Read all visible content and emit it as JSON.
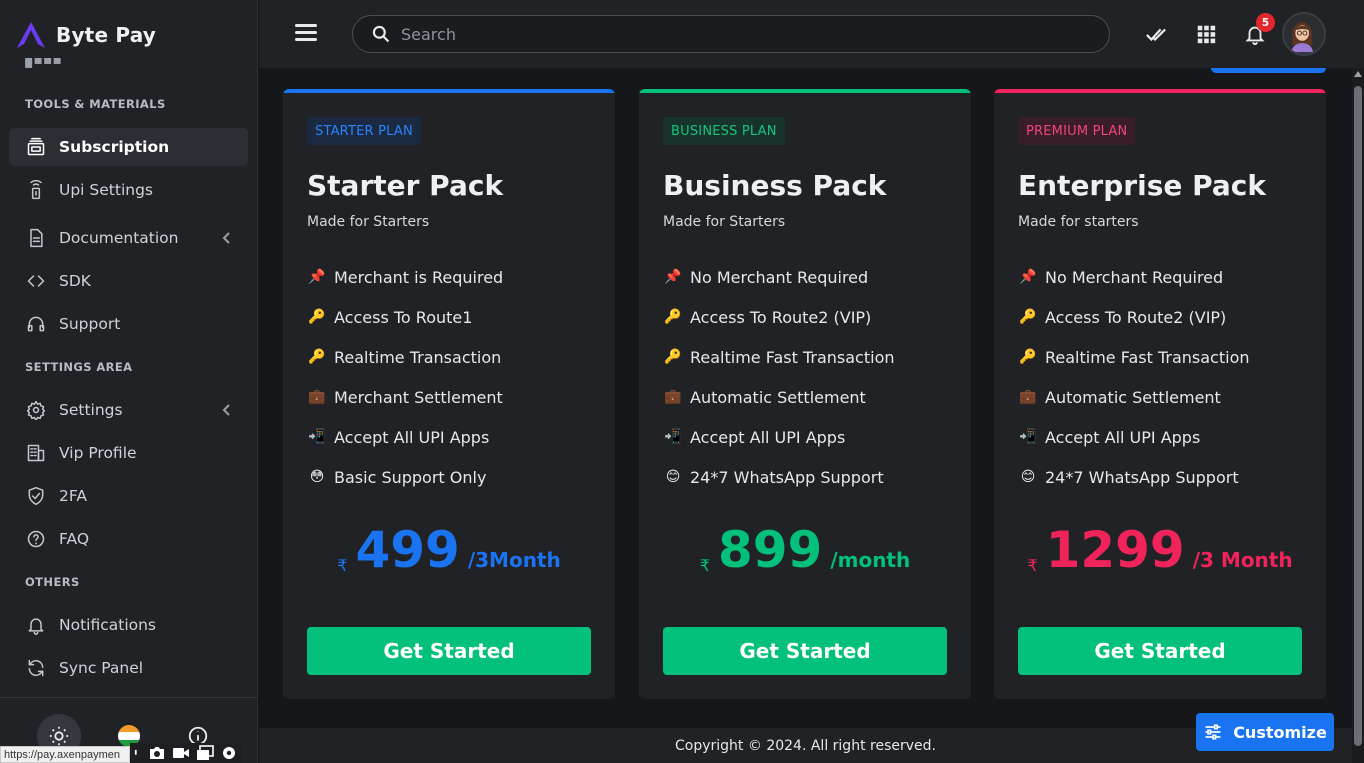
{
  "brand": {
    "name": "Byte Pay"
  },
  "sidebar": {
    "sections": [
      {
        "title": "TOOLS & MATERIALS"
      },
      {
        "title": "SETTINGS AREA"
      },
      {
        "title": "OTHERS"
      }
    ],
    "items": [
      {
        "label": "Subscription",
        "icon": "subscription-icon",
        "active": true
      },
      {
        "label": "Upi Settings",
        "icon": "upi-icon"
      },
      {
        "label": "Documentation",
        "icon": "document-icon",
        "chevron": true
      },
      {
        "label": "SDK",
        "icon": "code-icon"
      },
      {
        "label": "Support",
        "icon": "headset-icon"
      },
      {
        "label": "Settings",
        "icon": "gear-icon",
        "chevron": true
      },
      {
        "label": "Vip Profile",
        "icon": "building-icon"
      },
      {
        "label": "2FA",
        "icon": "shield-check-icon"
      },
      {
        "label": "FAQ",
        "icon": "help-circle-icon"
      },
      {
        "label": "Notifications",
        "icon": "bell-icon"
      },
      {
        "label": "Sync Panel",
        "icon": "sync-icon"
      }
    ]
  },
  "statusbar": {
    "url": "https://pay.axenpaymen"
  },
  "header": {
    "search_placeholder": "Search",
    "notification_count": "5"
  },
  "plans": [
    {
      "tag": "STARTER PLAN",
      "name": "Starter Pack",
      "subtitle": "Made for Starters",
      "color": "#1a73f0",
      "features": [
        {
          "emoji": "📌",
          "text": "Merchant is Required"
        },
        {
          "emoji": "🔑",
          "text": "Access To Route1"
        },
        {
          "emoji": "🔑",
          "text": "Realtime Transaction"
        },
        {
          "emoji": "💼",
          "text": "Merchant Settlement"
        },
        {
          "emoji": "📲",
          "text": "Accept All UPI Apps"
        },
        {
          "emoji": "😳",
          "text": "Basic Support Only"
        }
      ],
      "currency": "₹",
      "price": "499",
      "period": "/3Month",
      "cta": "Get Started"
    },
    {
      "tag": "BUSINESS PLAN",
      "name": "Business Pack",
      "subtitle": "Made for Starters",
      "color": "#03c07a",
      "features": [
        {
          "emoji": "📌",
          "text": "No Merchant Required"
        },
        {
          "emoji": "🔑",
          "text": "Access To Route2 (VIP)"
        },
        {
          "emoji": "🔑",
          "text": "Realtime Fast Transaction"
        },
        {
          "emoji": "💼",
          "text": "Automatic Settlement"
        },
        {
          "emoji": "📲",
          "text": "Accept All UPI Apps"
        },
        {
          "emoji": "😊",
          "text": "24*7 WhatsApp Support"
        }
      ],
      "currency": "₹",
      "price": "899",
      "period": "/month",
      "cta": "Get Started"
    },
    {
      "tag": "PREMIUM PLAN",
      "name": "Enterprise Pack",
      "subtitle": "Made for starters",
      "color": "#f0245a",
      "features": [
        {
          "emoji": "📌",
          "text": "No Merchant Required"
        },
        {
          "emoji": "🔑",
          "text": "Access To Route2 (VIP)"
        },
        {
          "emoji": "🔑",
          "text": "Realtime Fast Transaction"
        },
        {
          "emoji": "💼",
          "text": "Automatic Settlement"
        },
        {
          "emoji": "📲",
          "text": "Accept All UPI Apps"
        },
        {
          "emoji": "😊",
          "text": "24*7 WhatsApp Support"
        }
      ],
      "currency": "₹",
      "price": "1299",
      "period": "/3 Month",
      "cta": "Get Started"
    }
  ],
  "footer": {
    "text": "Copyright © 2024. All right reserved."
  },
  "customize": {
    "label": "Customize"
  },
  "colors": {
    "accent_blue": "#1a73f0",
    "accent_green": "#03c07a",
    "accent_pink": "#f0245a",
    "sidebar_bg": "#202226",
    "page_bg": "#15171b"
  }
}
